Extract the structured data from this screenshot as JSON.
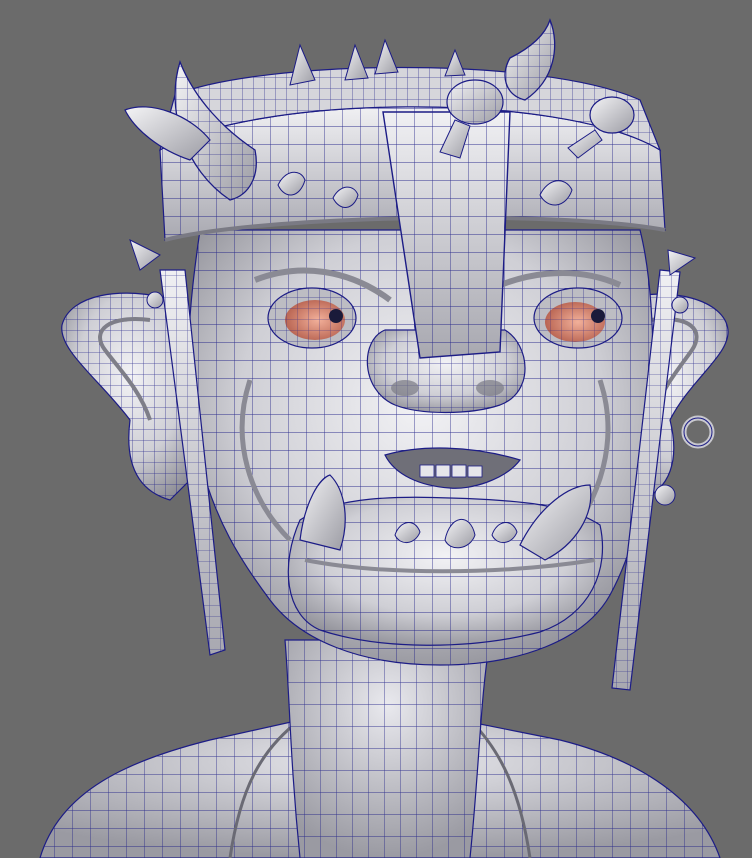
{
  "viewport": {
    "background_color": "#6b6b6b",
    "shading_mode": "smooth-shade-with-wireframe",
    "subject_icon": "ogre-head-icon"
  },
  "colors": {
    "surface_light": "#e6e6ea",
    "surface_mid": "#bdbdc3",
    "surface_dark": "#8a8a92",
    "wireframe": "#1c1c86",
    "eye_iris": "#d98a72",
    "pupil": "#1a1a3a"
  }
}
